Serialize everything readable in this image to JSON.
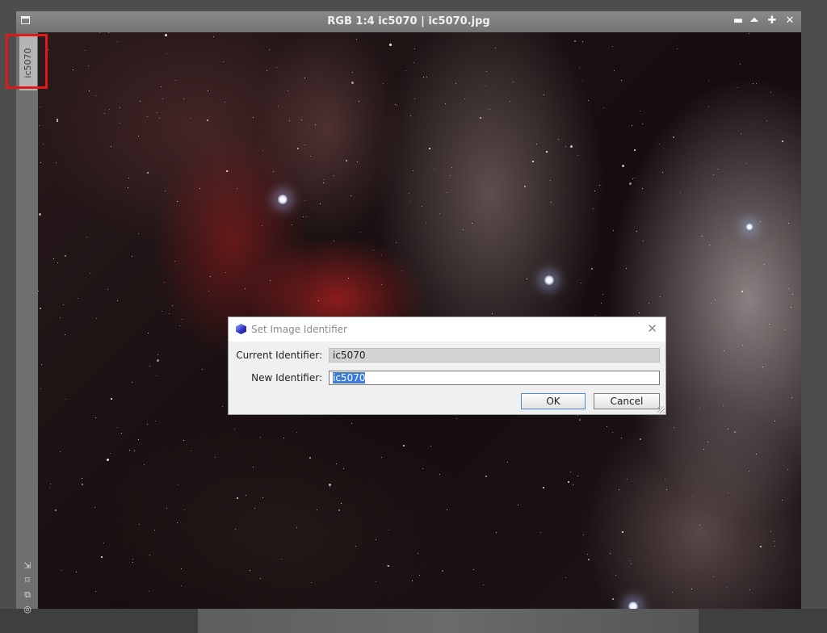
{
  "window": {
    "title": "RGB 1:4 ic5070 | ic5070.jpg",
    "controls": [
      {
        "name": "minimize-icon",
        "glyph": "▬"
      },
      {
        "name": "shade-icon",
        "glyph": "⏶"
      },
      {
        "name": "maximize-icon",
        "glyph": "✚"
      },
      {
        "name": "close-icon",
        "glyph": "✕"
      }
    ]
  },
  "sidebar": {
    "tab_label": "ic5070",
    "tools": [
      {
        "name": "zoom-to-fit-icon",
        "glyph": "⇲"
      },
      {
        "name": "fit-view-icon",
        "glyph": "⌑"
      },
      {
        "name": "clone-view-icon",
        "glyph": "⧉"
      },
      {
        "name": "target-icon",
        "glyph": "◎"
      }
    ]
  },
  "dialog": {
    "title": "Set Image Identifier",
    "close_glyph": "✕",
    "current_label": "Current Identifier:",
    "current_value": "ic5070",
    "new_label": "New Identifier:",
    "new_value": "ic5070",
    "ok_label": "OK",
    "cancel_label": "Cancel"
  },
  "colors": {
    "highlight": "#e0191b",
    "selection": "#3d7bd9",
    "ok_border": "#4e8ad8"
  }
}
